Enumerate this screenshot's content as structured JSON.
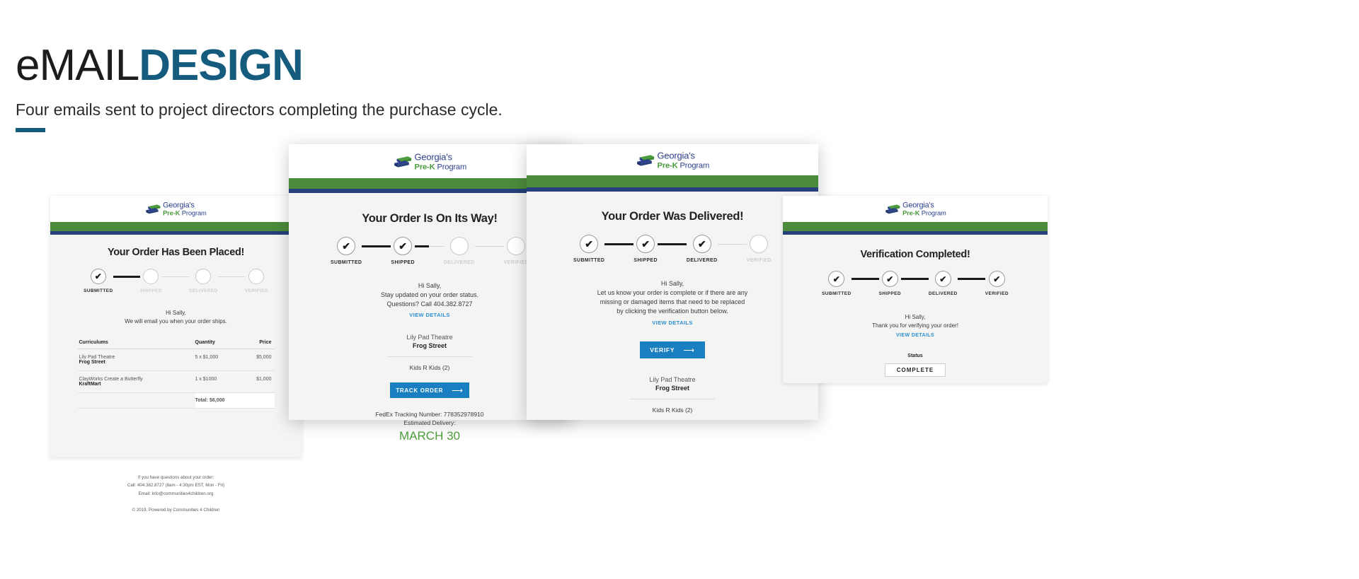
{
  "header": {
    "title_light": "eMAIL",
    "title_bold": "DESIGN",
    "subtitle": "Four emails sent to project directors completing the purchase cycle.",
    "accent_color": "#155b7e"
  },
  "logo": {
    "line1": "Georgia's",
    "prek": "Pre-K",
    "program": "Program"
  },
  "brand": {
    "green": "#4b8b3b",
    "navy": "#25407a",
    "button_blue": "#1a7fc1",
    "link_blue": "#2b8fd4",
    "date_green": "#4b9c3b"
  },
  "steps": {
    "submitted": "SUBMITTED",
    "shipped": "SHIPPED",
    "delivered": "DELIVERED",
    "verified": "VERIFIED",
    "check_glyph": "✔"
  },
  "email1": {
    "title": "Your Order Has Been Placed!",
    "greeting": "Hi Sally,",
    "body": "We will email you when your order ships.",
    "table": {
      "headers": [
        "Curriculums",
        "Quantity",
        "Price"
      ],
      "rows": [
        {
          "name": "Lily Pad Theatre",
          "vendor": "Frog Street",
          "quantity": "5 x $1,000",
          "price": "$5,000"
        },
        {
          "name": "ClayWorks Create a Butterfly",
          "vendor": "KraftMart",
          "quantity": "1 x $1000",
          "price": "$1,000"
        }
      ],
      "total_label": "Total: $6,000"
    },
    "footer": {
      "line1": "If you have questions about your order:",
      "line2": "Call: 404.382.8727 (8am - 4:30pm EST, Mon - Fri)",
      "line3": "Email: info@communities4children.org",
      "line4": "© 2019. Powered by Communities 4 Children"
    }
  },
  "email2": {
    "title": "Your Order Is On Its Way!",
    "greeting": "Hi Sally,",
    "body_line1": "Stay updated on your order status.",
    "body_line2": "Questions? Call 404.382.8727",
    "view_details": "VIEW DETAILS",
    "school_name": "Lily Pad Theatre",
    "school_sub": "Frog Street",
    "site": "Kids R Kids (2)",
    "button": "TRACK ORDER",
    "button_arrow": "⟶",
    "tracking": "FedEx Tracking Number: 778352978910",
    "estimated_label": "Estimated Delivery:",
    "estimated_date": "MARCH 30"
  },
  "email3": {
    "title": "Your Order Was Delivered!",
    "greeting": "Hi Sally,",
    "body_line1": "Let us know your order is complete or if there are any",
    "body_line2": "missing or damaged items that need to be replaced",
    "body_line3": "by clicking the verification button below.",
    "view_details": "VIEW DETAILS",
    "button": "VERIFY",
    "button_arrow": "⟶",
    "school_name": "Lily Pad Theatre",
    "school_sub": "Frog Street",
    "site": "Kids R Kids (2)"
  },
  "email4": {
    "title": "Verification Completed!",
    "greeting": "Hi Sally,",
    "body": "Thank you for verifying your order!",
    "view_details": "VIEW DETAILS",
    "status_label": "Status",
    "status_value": "COMPLETE"
  }
}
